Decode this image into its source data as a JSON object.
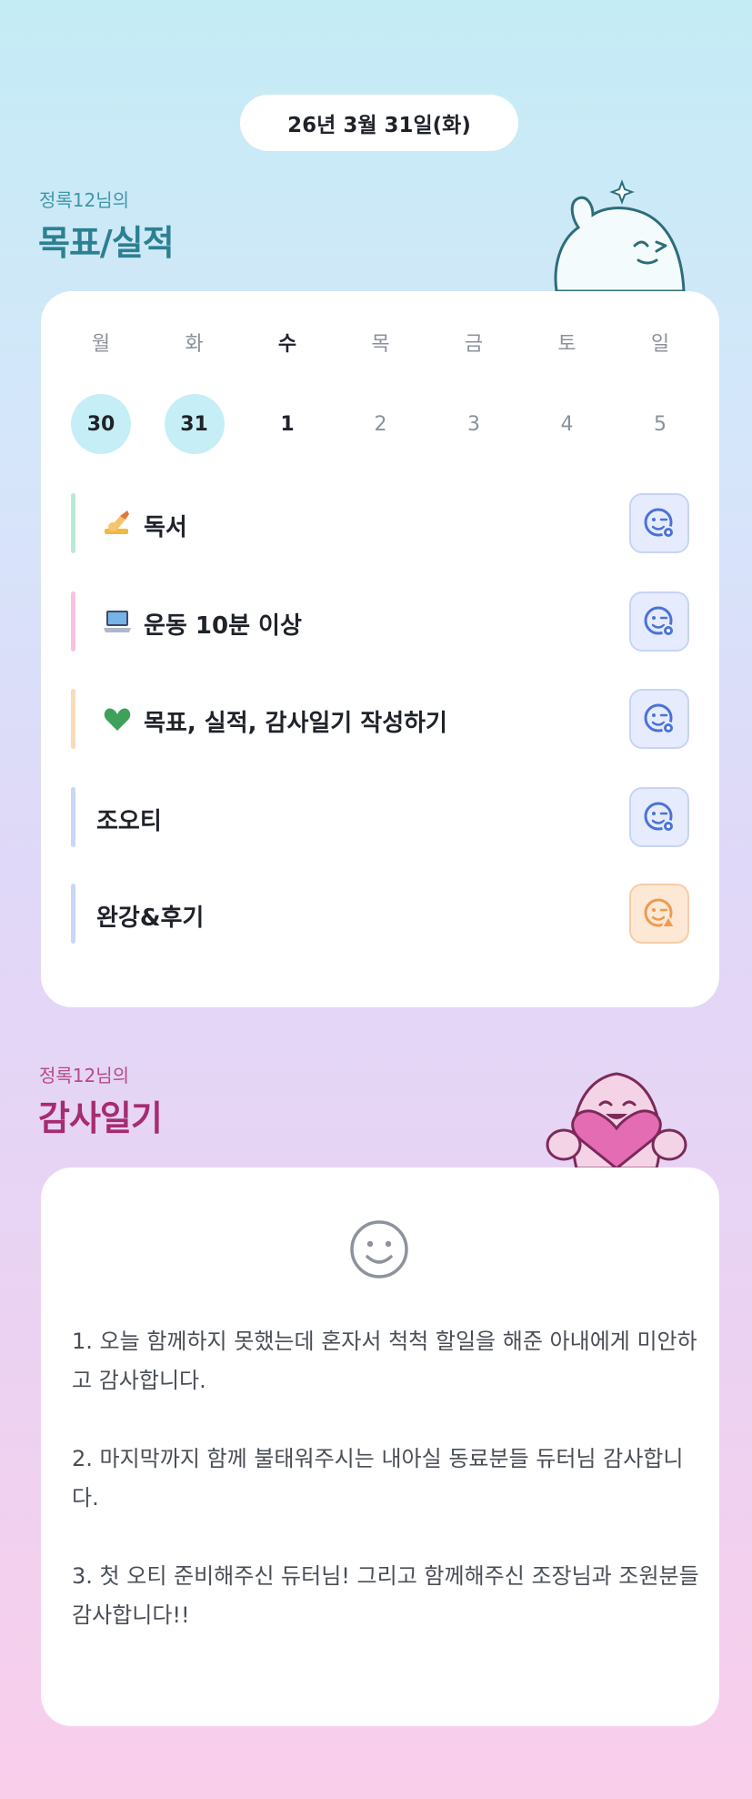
{
  "date_label": "26년 3월 31일(화)",
  "goals_section": {
    "subtitle": "정록12님의",
    "title": "목표/실적"
  },
  "week": {
    "days": [
      {
        "name": "월",
        "num": "30",
        "state": "done"
      },
      {
        "name": "화",
        "num": "31",
        "state": "done"
      },
      {
        "name": "수",
        "num": "1",
        "state": "today"
      },
      {
        "name": "목",
        "num": "2",
        "state": "future"
      },
      {
        "name": "금",
        "num": "3",
        "state": "future"
      },
      {
        "name": "토",
        "num": "4",
        "state": "future"
      },
      {
        "name": "일",
        "num": "5",
        "state": "future"
      }
    ]
  },
  "goals": [
    {
      "emoji": "writing-hand",
      "label": "독서",
      "bar_color": "#b9ead6",
      "status": "pending"
    },
    {
      "emoji": "laptop",
      "label": "운동 10분 이상",
      "bar_color": "#f6c2e0",
      "status": "pending"
    },
    {
      "emoji": "green-heart",
      "label": "목표, 실적, 감사일기 작성하기",
      "bar_color": "#f8dcb9",
      "status": "pending"
    },
    {
      "emoji": "",
      "label": "조오티",
      "bar_color": "#c9d6f5",
      "status": "pending"
    },
    {
      "emoji": "",
      "label": "완강&후기",
      "bar_color": "#c9d6f5",
      "status": "warning"
    }
  ],
  "diary_section": {
    "subtitle": "정록12님의",
    "title": "감사일기"
  },
  "diary": {
    "mood_icon": "smile-face-icon",
    "paragraphs": [
      "1. 오늘 함께하지 못했는데 혼자서 척척 할일을 해준 아내에게 미안하고 감사합니다.",
      "2. 마지막까지 함께 불태워주시는 내아실 동료분들 듀터님 감사합니다.",
      "3. 첫 오티 준비해주신 듀터님! 그리고 함께해주신 조장님과 조원분들 감사합니다!!"
    ]
  },
  "colors": {
    "goals_title": "#2c8091",
    "goals_subtitle": "#3f97a6",
    "diary_title": "#a62c72",
    "diary_subtitle": "#b44b86",
    "blue_status": "#4a73d8",
    "orange_status": "#ef9a4f"
  }
}
